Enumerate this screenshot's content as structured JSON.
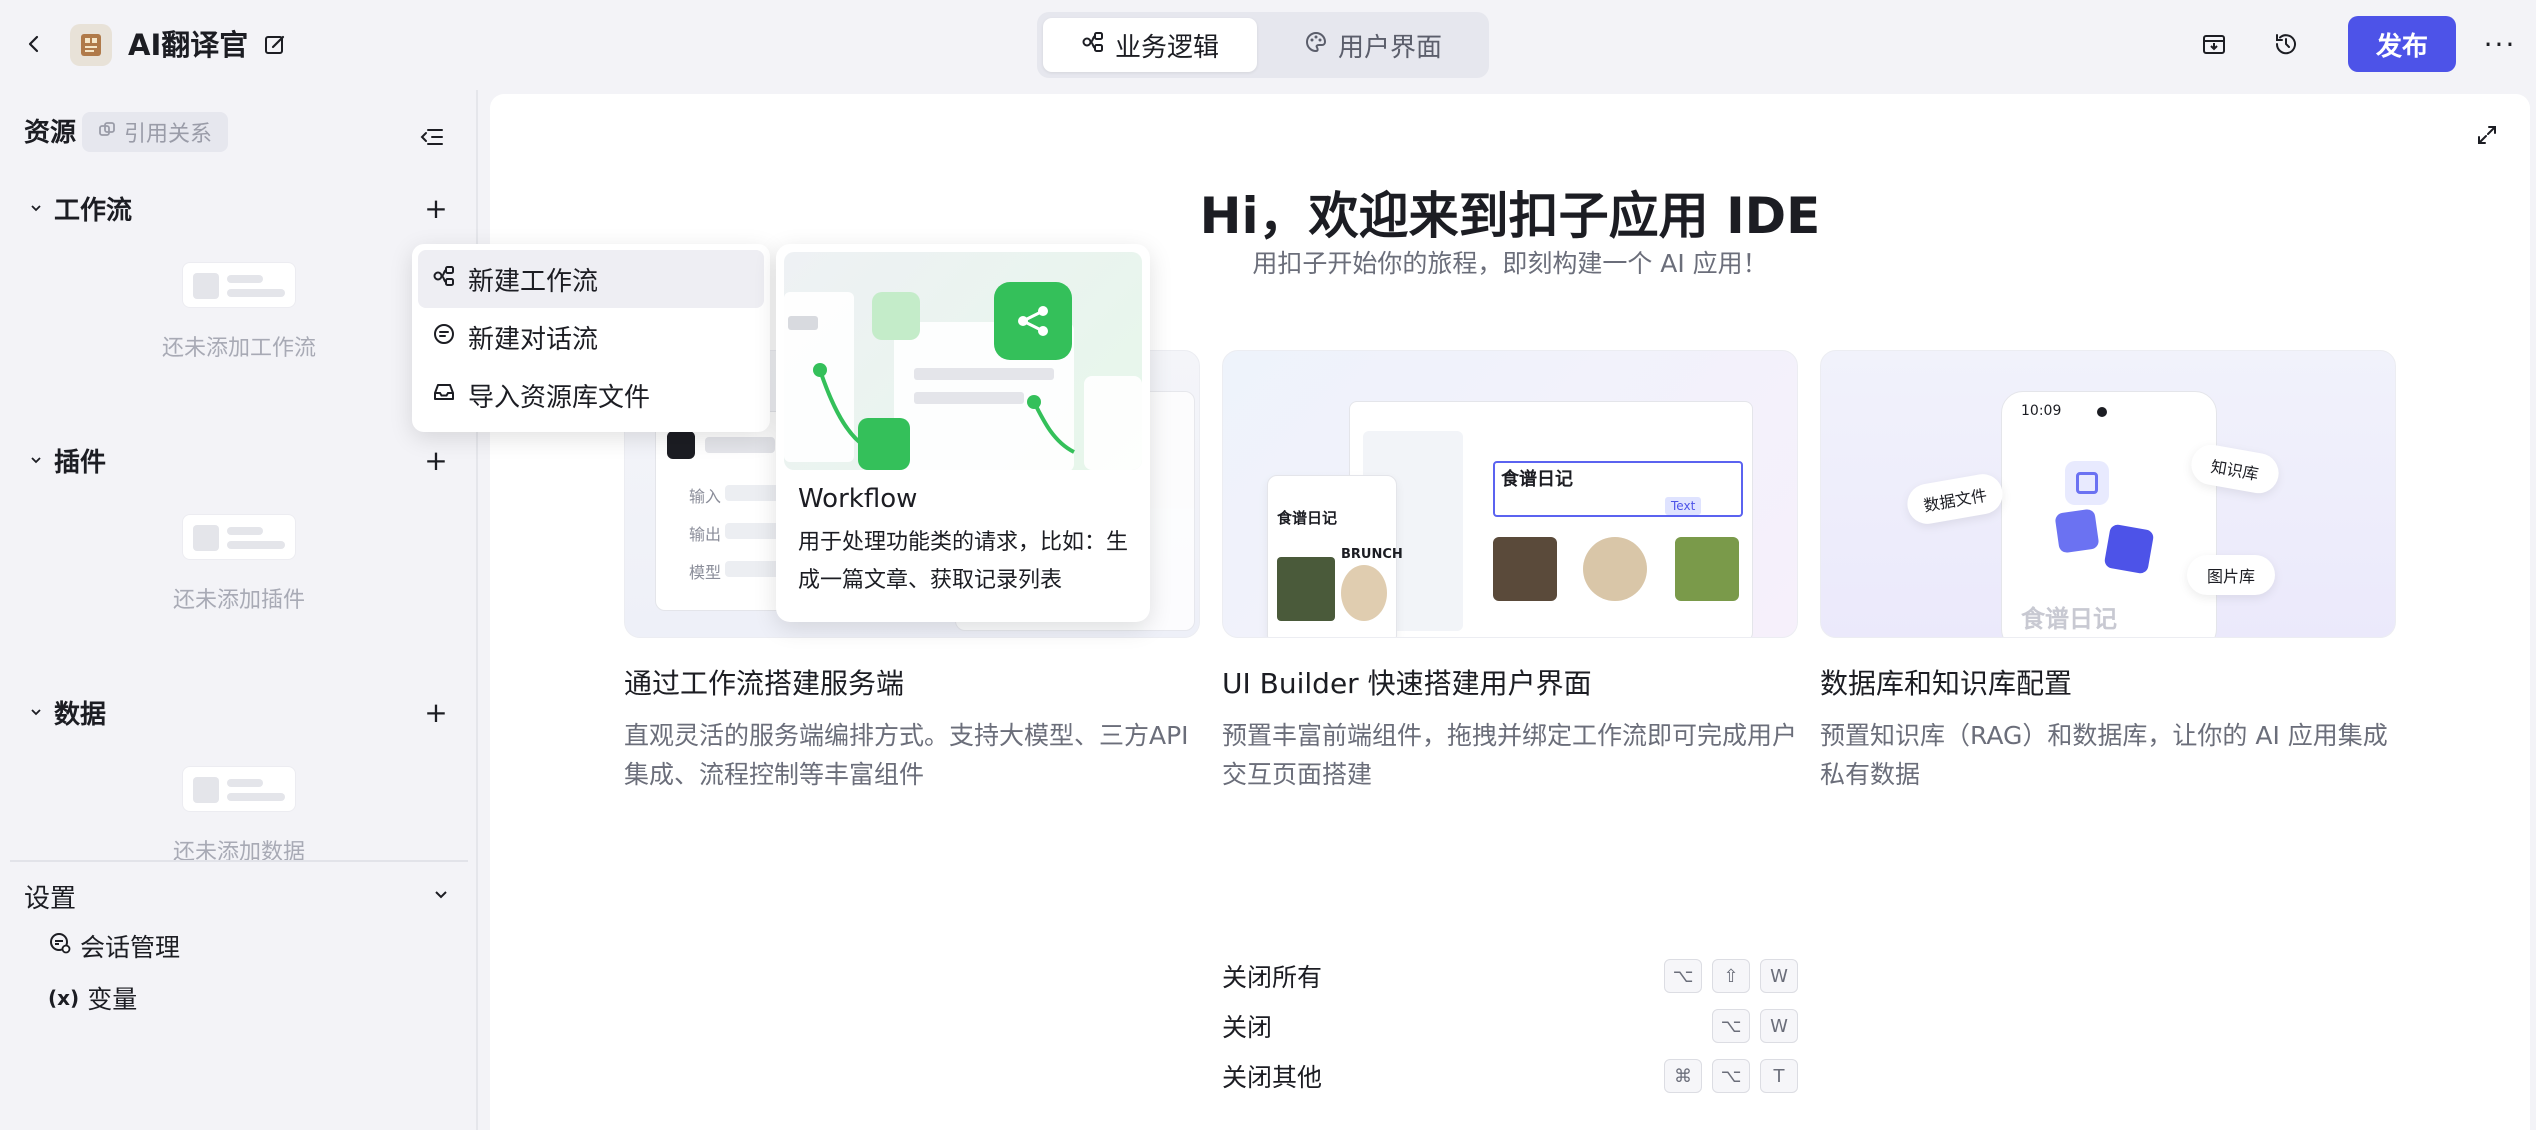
{
  "header": {
    "app_title": "AI翻译官",
    "tabs": [
      {
        "label": "业务逻辑",
        "icon": "workflow-icon",
        "active": true
      },
      {
        "label": "用户界面",
        "icon": "palette-icon",
        "active": false
      }
    ],
    "publish_label": "发布",
    "more_label": "···"
  },
  "sidebar": {
    "title": "资源",
    "ref_label": "引用关系",
    "sections": [
      {
        "label": "工作流",
        "empty_text": "还未添加工作流"
      },
      {
        "label": "插件",
        "empty_text": "还未添加插件"
      },
      {
        "label": "数据",
        "empty_text": "还未添加数据"
      }
    ],
    "settings": {
      "title": "设置",
      "items": [
        {
          "label": "会话管理",
          "icon": "chat-manage-icon"
        },
        {
          "label": "变量",
          "icon": "variable-icon"
        }
      ]
    }
  },
  "main": {
    "title": "Hi，欢迎来到扣子应用 IDE",
    "subtitle": "用扣子开始你的旅程，即刻构建一个 AI 应用！",
    "cards": [
      {
        "title": "通过工作流搭建服务端",
        "desc": "直观灵活的服务端编排方式。支持大模型、三方API集成、流程控制等丰富组件"
      },
      {
        "title": "UI Builder 快速搭建用户界面",
        "desc": "预置丰富前端组件，拖拽并绑定工作流即可完成用户交互页面搭建"
      },
      {
        "title": "数据库和知识库配置",
        "desc": "预置知识库（RAG）和数据库，让你的 AI 应用集成私有数据"
      }
    ],
    "card1_labels": {
      "input": "输入",
      "output": "输出",
      "model": "模型"
    },
    "card2_labels": {
      "recipe": "食谱日记",
      "brunch": "BRUNCH",
      "text": "Text"
    },
    "card3_labels": {
      "time": "10:09",
      "data_file": "数据文件",
      "knowledge": "知识库",
      "image_lib": "图片库",
      "recipe": "食谱日记"
    },
    "shortcuts": [
      {
        "label": "关闭所有",
        "keys": [
          "⌥",
          "⇧",
          "W"
        ]
      },
      {
        "label": "关闭",
        "keys": [
          "⌥",
          "W"
        ]
      },
      {
        "label": "关闭其他",
        "keys": [
          "⌘",
          "⌥",
          "T"
        ]
      }
    ]
  },
  "dropdown": {
    "items": [
      {
        "label": "新建工作流",
        "icon": "workflow-icon"
      },
      {
        "label": "新建对话流",
        "icon": "chatflow-icon"
      },
      {
        "label": "导入资源库文件",
        "icon": "inbox-icon"
      }
    ],
    "preview": {
      "title": "Workflow",
      "desc": "用于处理功能类的请求，比如：生成一篇文章、获取记录列表"
    }
  },
  "colors": {
    "accent": "#4d53e8",
    "background": "#f3f3f7",
    "green": "#3ec254"
  }
}
